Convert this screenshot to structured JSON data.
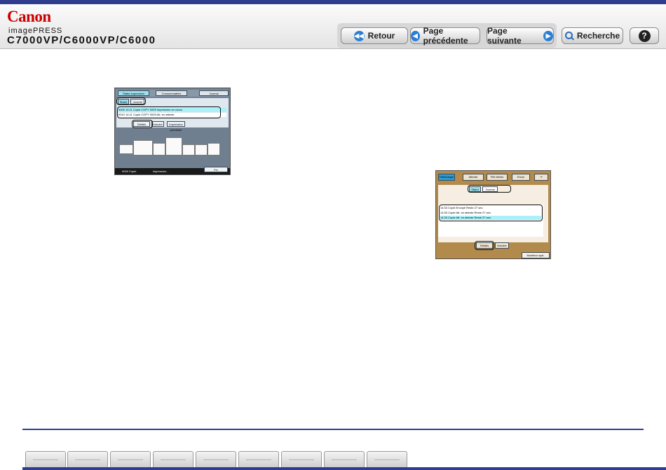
{
  "header": {
    "brand": "Canon",
    "product": "imagePRESS",
    "model": "C7000VP/C6000VP/C6000"
  },
  "nav": {
    "back_label": "Retour",
    "prev_label": "Page précédente",
    "next_label": "Page suivante",
    "search_label": "Recherche",
    "help_label": "?"
  },
  "screen1": {
    "tabs": [
      "Statut impression",
      "Consommables",
      "Journal"
    ],
    "filters": [
      "Statut",
      "Journal"
    ],
    "rows": [
      "0009 14:11 Copie     COPY 0009   Impression en cours",
      "0010 14:11 Copie     COPY 0009   Att. en attente"
    ],
    "buttons": [
      "Détails",
      "Annuler",
      "Impression prioritaire"
    ],
    "status": "0009 Copie",
    "status_right": "Impression...",
    "close": "Fin"
  },
  "screen2": {
    "tabs": [
      "Télécharger",
      "Attente",
      "File lettres",
      "Envoi"
    ],
    "filters": [
      "Statut",
      "Journal"
    ],
    "rows": [
      "14:33 Copie     Envoyé      Reste 27 sec.",
      "14:33 Copie     Att. en attente  Reste 27 sec.",
      "14:33 Copie     Att. en attente  Reste 27 sec."
    ],
    "buttons": [
      "Détails",
      "Annuler"
    ],
    "footer": "Moniteur syst."
  },
  "footer_tabs": [
    "",
    "",
    "",
    "",
    "",
    "",
    "",
    "",
    "",
    ""
  ]
}
